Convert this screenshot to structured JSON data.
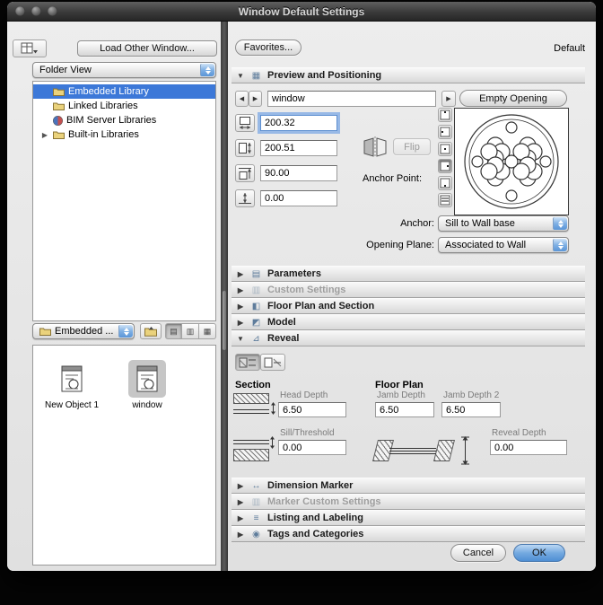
{
  "window": {
    "title": "Window Default Settings"
  },
  "left": {
    "load_button": "Load Other Window...",
    "view_select": "Folder View",
    "tree": [
      {
        "label": "Embedded Library"
      },
      {
        "label": "Linked Libraries"
      },
      {
        "label": "BIM Server Libraries"
      },
      {
        "label": "Built-in Libraries"
      }
    ],
    "library_select": "Embedded ...",
    "items": [
      {
        "label": "New Object 1"
      },
      {
        "label": "window"
      }
    ]
  },
  "right": {
    "favorites_button": "Favorites...",
    "state_label": "Default",
    "preview": {
      "title": "Preview and Positioning",
      "name_value": "window",
      "empty_opening_button": "Empty Opening",
      "width_value": "200.32",
      "height_value": "200.51",
      "header_value": "90.00",
      "sill_value": "0.00",
      "flip_button": "Flip",
      "anchor_point_label": "Anchor Point:",
      "anchor_label": "Anchor:",
      "anchor_value": "Sill to Wall base",
      "opening_plane_label": "Opening Plane:",
      "opening_plane_value": "Associated to Wall"
    },
    "sections": [
      {
        "label": "Parameters"
      },
      {
        "label": "Custom Settings"
      },
      {
        "label": "Floor Plan and Section"
      },
      {
        "label": "Model"
      },
      {
        "label": "Reveal"
      }
    ],
    "reveal": {
      "section_label": "Section",
      "floor_plan_label": "Floor Plan",
      "head_depth_label": "Head Depth",
      "head_depth_value": "6.50",
      "sill_threshold_label": "Sill/Threshold",
      "sill_threshold_value": "0.00",
      "jamb_depth_label": "Jamb Depth",
      "jamb_depth_value": "6.50",
      "jamb_depth2_label": "Jamb Depth 2",
      "jamb_depth2_value": "6.50",
      "reveal_depth_label": "Reveal Depth",
      "reveal_depth_value": "0.00"
    },
    "bottom_sections": [
      {
        "label": "Dimension Marker"
      },
      {
        "label": "Marker Custom Settings"
      },
      {
        "label": "Listing and Labeling"
      },
      {
        "label": "Tags and Categories"
      }
    ],
    "cancel_button": "Cancel",
    "ok_button": "OK"
  }
}
